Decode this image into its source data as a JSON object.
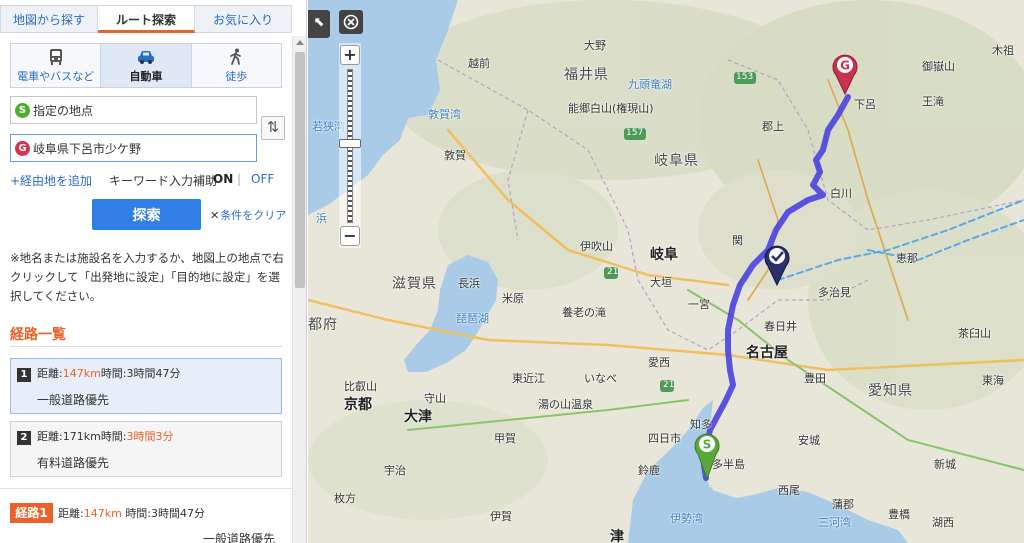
{
  "tabs": [
    "地図から探す",
    "ルート探索",
    "お気に入り"
  ],
  "modes": {
    "train": "電車やバスなど",
    "car": "自動車",
    "walk": "徒歩"
  },
  "form": {
    "start_badge": "S",
    "start_value": "指定の地点",
    "goal_badge": "G",
    "goal_value": "岐阜県下呂市少ケ野",
    "swap_icon": "⇅",
    "add_waypoint": "+経由地を追加",
    "keyword_label": "キーワード入力補助",
    "keyword_on": "ON",
    "keyword_sep": "|",
    "keyword_off": "OFF",
    "search": "探索",
    "clear": "条件をクリア",
    "clear_mark": "✕"
  },
  "note": "※地名または施設名を入力するか、地図上の地点で右クリックして「出発地に設定」「目的地に設定」を選択してください。",
  "route_list": {
    "title": "経路一覧",
    "routes": [
      {
        "num": "1",
        "dist_label": "距離:",
        "dist": "147km",
        "time_label": "時間:",
        "time": "3時間47分",
        "priority": "一般道路優先"
      },
      {
        "num": "2",
        "dist_label": "距離:",
        "dist": "171km",
        "time_label": "時間:",
        "time": "3時間3分",
        "priority": "有料道路優先"
      }
    ]
  },
  "detail": {
    "tag": "経路1",
    "dist_label": "距離:",
    "dist": "147km",
    "time_label": "時間:",
    "time": "3時間47分",
    "priority": "一般道路優先"
  },
  "map": {
    "labels": {
      "fukui": "福井県",
      "gifu_pref": "岐阜県",
      "shiga": "滋賀県",
      "aichi": "愛知県",
      "kyoto_fu": "都府",
      "ono": "大野",
      "echizen": "越前",
      "kuzuryu": "九頭竜湖",
      "nohaku": "能郷白山(権現山)",
      "gujo": "郡上",
      "gero": "下呂",
      "ouchi": "王滝",
      "ontake": "御嶽山",
      "kiso": "木祖",
      "tsuruga_bay": "敦賀湾",
      "wakasa": "若狭湾",
      "tsuruga": "敦賀",
      "hama": "浜",
      "shirakawa": "白川",
      "seki": "関",
      "gifu": "岐阜",
      "ibuki": "伊吹山",
      "ogaki": "大垣",
      "ena": "恵那",
      "tajimi": "多治見",
      "nagahama": "長浜",
      "maibara": "米原",
      "ichinomiya": "一宮",
      "kasugai": "春日井",
      "yoro": "養老の滝",
      "biwako": "琵琶湖",
      "nagoya": "名古屋",
      "chausu": "茶臼山",
      "aisai": "愛西",
      "higashiomi": "東近江",
      "inabe": "いなべ",
      "toyota": "豊田",
      "hieizan": "比叡山",
      "kyoto": "京都",
      "moriyama": "守山",
      "otsu": "大津",
      "yunoyama": "湯の山温泉",
      "tokai": "東海",
      "chita": "知多",
      "koga": "甲賀",
      "yokkaichi": "四日市",
      "anjo": "安城",
      "uji": "宇治",
      "suzuka": "鈴鹿",
      "chita_peninsula": "多半島",
      "nishio": "西尾",
      "shinshiro": "新城",
      "hirakata": "枚方",
      "iga": "伊賀",
      "gamagori": "蒲郡",
      "toyohashi": "豊橋",
      "kosai": "湖西",
      "ise_bay": "伊勢湾",
      "mikawa_bay": "三河湾",
      "tsu": "津",
      "r21a": "21",
      "r21b": "21",
      "r157": "157",
      "r153": "153",
      "r19": "19"
    },
    "pin_start": "S",
    "pin_goal": "G"
  }
}
